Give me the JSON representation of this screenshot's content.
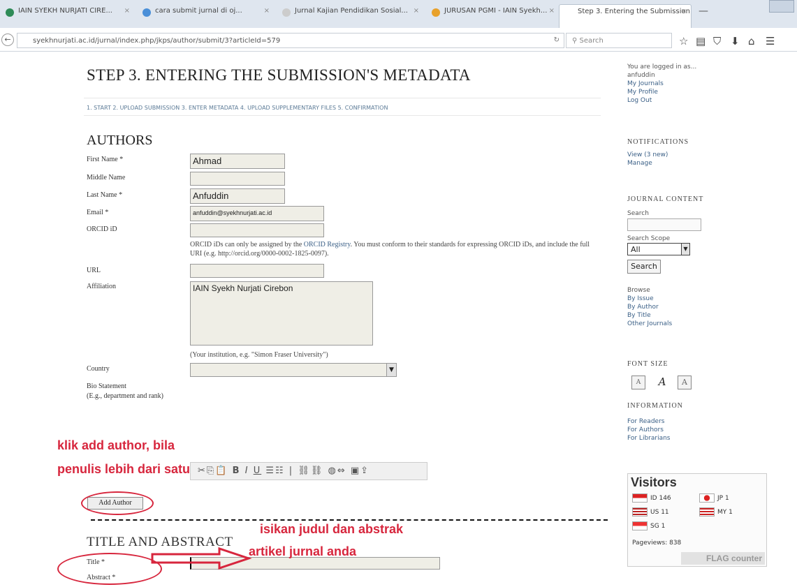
{
  "caption": "copy",
  "browser": {
    "tabs": [
      "IAIN SYEKH NURJATI CIRE...",
      "cara submit jurnal di oj...",
      "Jurnal Kajian Pendidikan Sosial...",
      "JURUSAN PGMI - IAIN Syekh...",
      "Step 3. Entering the Submission..."
    ],
    "url": "syekhnurjati.ac.id/jurnal/index.php/jkps/author/submit/3?articleId=579",
    "search_placeholder": "Search"
  },
  "main": {
    "title": "STEP 3. ENTERING THE SUBMISSION'S METADATA",
    "steps": "1. START   2. UPLOAD SUBMISSION   3. ENTER METADATA   4. UPLOAD SUPPLEMENTARY FILES   5. CONFIRMATION",
    "authors_heading": "AUTHORS",
    "labels": {
      "first_name": "First Name *",
      "middle_name": "Middle Name",
      "last_name": "Last Name *",
      "email": "Email *",
      "orcid": "ORCID iD",
      "url": "URL",
      "affiliation": "Affiliation",
      "country": "Country",
      "bio": "Bio Statement",
      "bio_hint": "(E.g., department and rank)"
    },
    "values": {
      "first_name": "Ahmad",
      "middle_name": "",
      "last_name": "Anfuddin",
      "email": "anfuddin@syekhnurjati.ac.id",
      "affiliation": "IAIN Syekh Nurjati Cirebon"
    },
    "orcid_help_prefix": "ORCID iDs can only be assigned by the ",
    "orcid_help_link": "ORCID Registry",
    "orcid_help_suffix": ". You must conform to their standards for expressing ORCID iDs, and include the full URI (e.g. http://orcid.org/0000-0002-1825-0097).",
    "affiliation_hint": "(Your institution, e.g. \"Simon Fraser University\")",
    "add_author": "Add Author",
    "title_heading": "TITLE AND ABSTRACT",
    "title_label": "Title *",
    "abstract_label": "Abstract *"
  },
  "annotations": {
    "add_author_line1": "klik add author, bila",
    "add_author_line2": "penulis lebih dari satu",
    "title_line1": "isikan judul dan abstrak",
    "title_line2": "artikel jurnal anda"
  },
  "sidebar": {
    "user_line1": "You are logged in as...",
    "user_line2": "anfuddin",
    "user_links": [
      "My Journals",
      "My Profile",
      "Log Out"
    ],
    "notifications_heading": "NOTIFICATIONS",
    "notifications_links": [
      "View (3 new)",
      "Manage"
    ],
    "journal_content_heading": "JOURNAL CONTENT",
    "search_label": "Search",
    "search_scope_label": "Search Scope",
    "search_scope_value": "All",
    "search_button": "Search",
    "browse_label": "Browse",
    "browse_links": [
      "By Issue",
      "By Author",
      "By Title",
      "Other Journals"
    ],
    "font_size_heading": "FONT SIZE",
    "font_sizes": [
      "A",
      "A",
      "A"
    ],
    "information_heading": "INFORMATION",
    "information_links": [
      "For Readers",
      "For Authors",
      "For Librarians"
    ]
  },
  "visitors": {
    "title": "Visitors",
    "entries": [
      {
        "code": "ID",
        "count": "146"
      },
      {
        "code": "US",
        "count": "11"
      },
      {
        "code": "SG",
        "count": "1"
      },
      {
        "code": "JP",
        "count": "1"
      },
      {
        "code": "MY",
        "count": "1"
      }
    ],
    "pageviews": "Pageviews: 838",
    "logo": "FLAG counter"
  }
}
